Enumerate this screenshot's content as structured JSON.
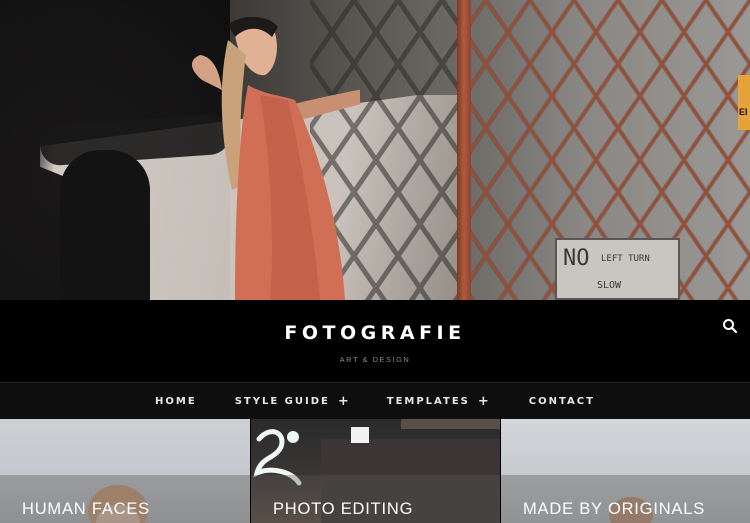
{
  "site": {
    "title": "FOTOGRAFIE",
    "tagline": "ART & DESIGN"
  },
  "hero": {
    "sign_line1": "NO",
    "sign_line2": "LEFT TURN",
    "sign_line3": "SLOW",
    "edge_tag_text": "EI"
  },
  "nav": {
    "items": [
      {
        "label": "HOME",
        "has_submenu": false
      },
      {
        "label": "STYLE GUIDE",
        "has_submenu": true
      },
      {
        "label": "TEMPLATES",
        "has_submenu": true
      },
      {
        "label": "CONTACT",
        "has_submenu": false
      }
    ],
    "submenu_glyph": "+"
  },
  "cards": [
    {
      "label": "HUMAN FACES"
    },
    {
      "label": "PHOTO EDITING"
    },
    {
      "label": "MADE BY ORIGINALS"
    }
  ],
  "icons": {
    "search": "search-icon",
    "plus": "plus-icon"
  },
  "colors": {
    "header_bg": "#000000",
    "nav_bg": "#0e0e0e",
    "fence": "#b4583a",
    "accent_tag": "#e5a33a"
  }
}
